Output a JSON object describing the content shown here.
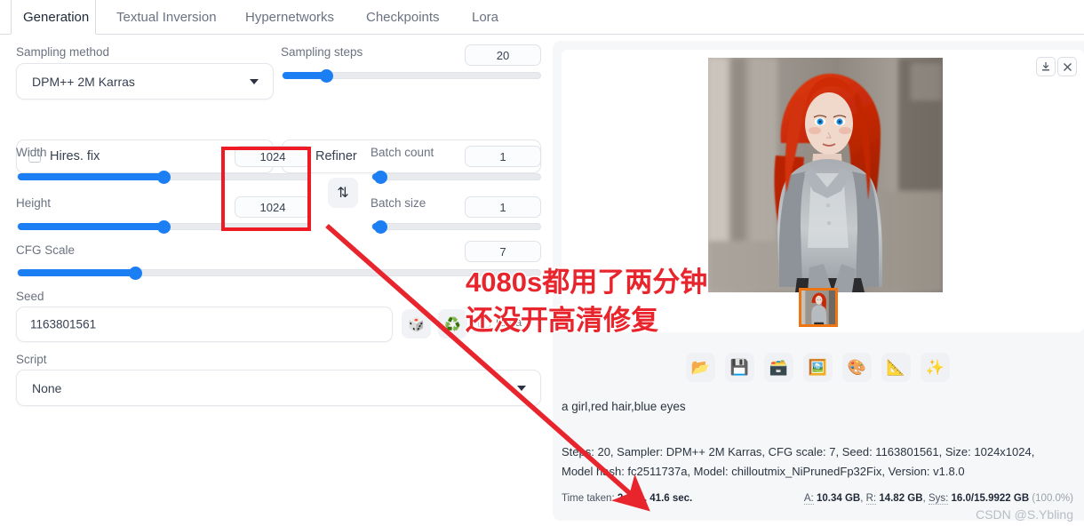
{
  "tabs": [
    {
      "label": "Generation",
      "active": true
    },
    {
      "label": "Textual Inversion",
      "active": false
    },
    {
      "label": "Hypernetworks",
      "active": false
    },
    {
      "label": "Checkpoints",
      "active": false
    },
    {
      "label": "Lora",
      "active": false
    }
  ],
  "left": {
    "sampling_method_label": "Sampling method",
    "sampling_method_value": "DPM++ 2M Karras",
    "sampling_steps_label": "Sampling steps",
    "sampling_steps_value": "20",
    "hires_fix_label": "Hires. fix",
    "refiner_label": "Refiner",
    "width_label": "Width",
    "width_value": "1024",
    "height_label": "Height",
    "height_value": "1024",
    "swap_icon": "swap-dimensions-icon",
    "batch_count_label": "Batch count",
    "batch_count_value": "1",
    "batch_size_label": "Batch size",
    "batch_size_value": "1",
    "cfg_scale_label": "CFG Scale",
    "cfg_scale_value": "7",
    "seed_label": "Seed",
    "seed_value": "1163801561",
    "seed_dice_icon": "🎲",
    "seed_recycle_icon": "♻️",
    "extra_label": "Extra",
    "script_label": "Script",
    "script_value": "None"
  },
  "right": {
    "download_icon": "download-icon",
    "close_icon": "close-icon",
    "toolbar": [
      {
        "name": "open-folder-button",
        "icon": "📂"
      },
      {
        "name": "save-button",
        "icon": "💾"
      },
      {
        "name": "save-zip-button",
        "icon": "🗃️"
      },
      {
        "name": "send-to-img2img-button",
        "icon": "🖼️"
      },
      {
        "name": "send-to-inpaint-button",
        "icon": "🎨"
      },
      {
        "name": "send-to-extras-button",
        "icon": "📐"
      },
      {
        "name": "upscale-button",
        "icon": "✨"
      }
    ],
    "prompt": "a girl,red hair,blue eyes",
    "meta_line": "Steps: 20, Sampler: DPM++ 2M Karras, CFG scale: 7, Seed: 1163801561, Size: 1024x1024, Model hash: fc2511737a, Model: chilloutmix_NiPrunedFp32Fix, Version: v1.8.0",
    "time_taken_prefix": "Time taken:",
    "time_taken_value": "2 min. 41.6 sec.",
    "mem_a_key": "A:",
    "mem_a_value": "10.34 GB",
    "mem_r_key": "R:",
    "mem_r_value": "14.82 GB",
    "mem_sys_key": "Sys:",
    "mem_sys_value": "16.0/15.9922 GB",
    "mem_sys_pct": "(100.0%)",
    "watermark": "CSDN @S.Ybling"
  },
  "annotations": {
    "line1": "4080s都用了两分钟",
    "line2": "还没开高清修复",
    "highlight_color": "#ee1b24",
    "text_color": "#e8252d",
    "arrow_color": "#e8252d"
  }
}
